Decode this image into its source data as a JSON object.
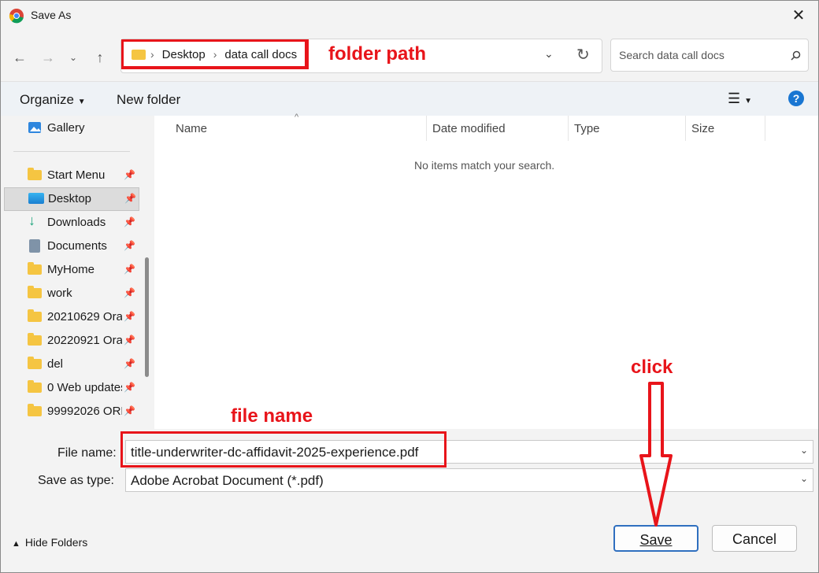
{
  "window": {
    "title": "Save As"
  },
  "navigation": {
    "path": [
      "Desktop",
      "data call docs"
    ],
    "search_placeholder": "Search data call docs"
  },
  "toolbar": {
    "organize_label": "Organize",
    "new_folder_label": "New folder"
  },
  "sidebar": {
    "top_item": "Gallery",
    "items": [
      {
        "label": "Start Menu",
        "selected": false
      },
      {
        "label": "Desktop",
        "selected": true
      },
      {
        "label": "Downloads",
        "selected": false
      },
      {
        "label": "Documents",
        "selected": false
      },
      {
        "label": "MyHome",
        "selected": false
      },
      {
        "label": "work",
        "selected": false
      },
      {
        "label": "20210629 Orac",
        "selected": false
      },
      {
        "label": "20220921 Orac",
        "selected": false
      },
      {
        "label": "del",
        "selected": false
      },
      {
        "label": "0 Web updates",
        "selected": false
      },
      {
        "label": "99992026 ORR",
        "selected": false
      }
    ]
  },
  "file_list": {
    "columns": [
      "Name",
      "Date modified",
      "Type",
      "Size"
    ],
    "empty_message": "No items match your search."
  },
  "form": {
    "file_name_label": "File name:",
    "file_name_value": "title-underwriter-dc-affidavit-2025-experience.pdf",
    "save_type_label": "Save as type:",
    "save_type_value": "Adobe Acrobat Document (*.pdf)"
  },
  "footer": {
    "hide_folders_label": "Hide Folders",
    "save_label": "Save",
    "cancel_label": "Cancel"
  },
  "annotations": {
    "folder_path": "folder path",
    "file_name": "file name",
    "click": "click"
  },
  "colors": {
    "annotation_red": "#e8141a",
    "accent_blue": "#2f6fbf"
  }
}
